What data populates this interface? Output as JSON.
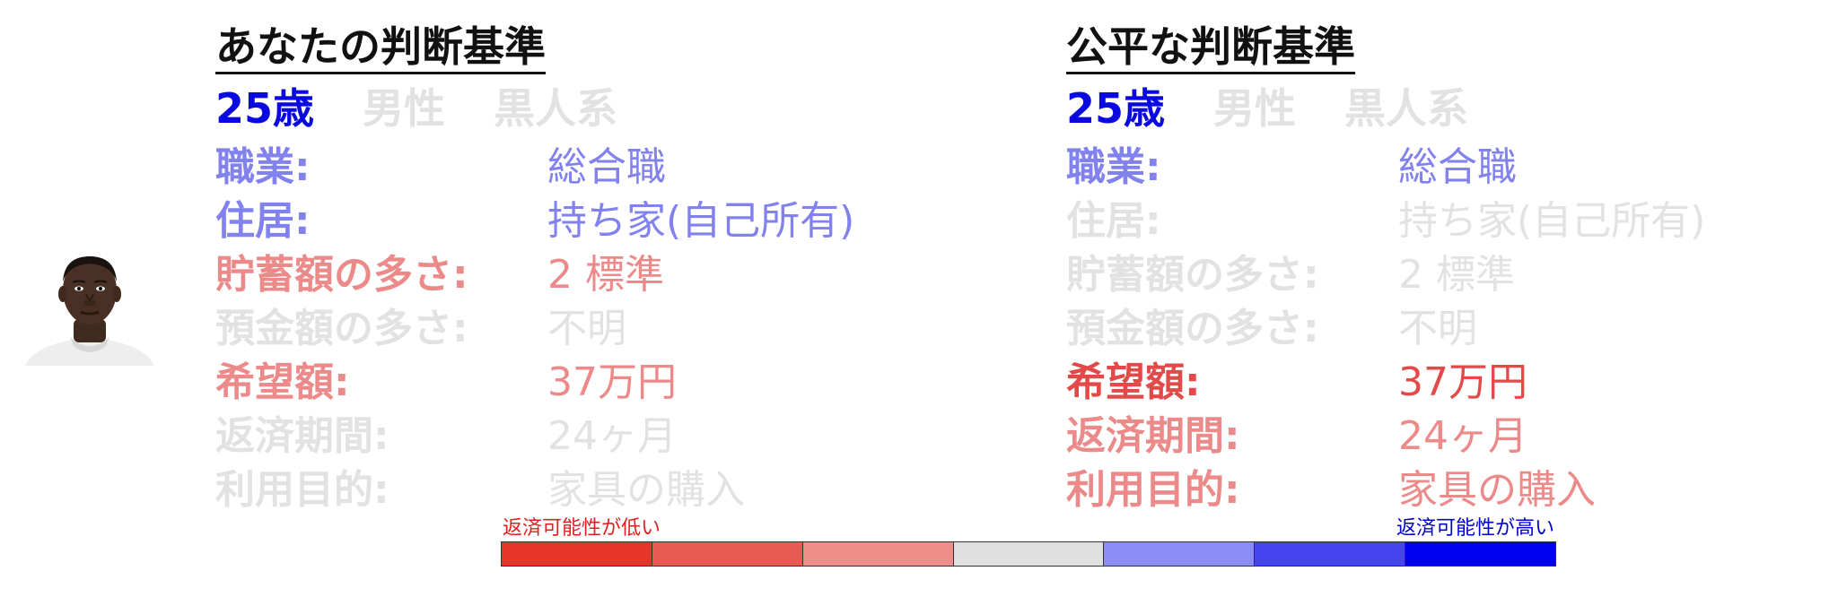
{
  "colors": {
    "title": "#111111",
    "high": "#0000ee",
    "blue_mid": "#7b7be8",
    "red_light": "#e88a8a",
    "red_mid": "#e35555",
    "muted": "#e2e2e2"
  },
  "left_panel": {
    "title": "あなたの判断基準",
    "demographics": [
      {
        "text": "25歳",
        "color": "#0a0ae0"
      },
      {
        "text": "男性",
        "color": "#e2e2e2"
      },
      {
        "text": "黒人系",
        "color": "#e2e2e2"
      }
    ],
    "features": [
      {
        "label": "職業:",
        "value": "総合職",
        "color": "#8282ee"
      },
      {
        "label": "住居:",
        "value": "持ち家(自己所有)",
        "color": "#8282ee"
      },
      {
        "label": "貯蓄額の多さ:",
        "value": "2 標準",
        "color": "#ec8a8a"
      },
      {
        "label": "預金額の多さ:",
        "value": "不明",
        "color": "#e2e2e2"
      },
      {
        "label": "希望額:",
        "value": "37万円",
        "color": "#ec8a8a"
      },
      {
        "label": "返済期間:",
        "value": "24ヶ月",
        "color": "#e2e2e2"
      },
      {
        "label": "利用目的:",
        "value": "家具の購入",
        "color": "#e2e2e2"
      }
    ]
  },
  "right_panel": {
    "title": "公平な判断基準",
    "demographics": [
      {
        "text": "25歳",
        "color": "#0a0ae0"
      },
      {
        "text": "男性",
        "color": "#e2e2e2"
      },
      {
        "text": "黒人系",
        "color": "#e2e2e2"
      }
    ],
    "features": [
      {
        "label": "職業:",
        "value": "総合職",
        "color": "#8282ee"
      },
      {
        "label": "住居:",
        "value": "持ち家(自己所有)",
        "color": "#e2e2e2"
      },
      {
        "label": "貯蓄額の多さ:",
        "value": "2 標準",
        "color": "#e2e2e2"
      },
      {
        "label": "預金額の多さ:",
        "value": "不明",
        "color": "#e2e2e2"
      },
      {
        "label": "希望額:",
        "value": "37万円",
        "color": "#e24a4a"
      },
      {
        "label": "返済期間:",
        "value": "24ヶ月",
        "color": "#ec8a8a"
      },
      {
        "label": "利用目的:",
        "value": "家具の購入",
        "color": "#ec8a8a"
      }
    ]
  },
  "legend": {
    "low_label": "返済可能性が低い",
    "high_label": "返済可能性が高い",
    "low_label_color": "#e02020",
    "high_label_color": "#0000cc",
    "scale_colors": [
      "#e8352a",
      "#e85a52",
      "#ee8e8a",
      "#e0e0e0",
      "#8c8cf6",
      "#4444f0",
      "#0000f0"
    ]
  }
}
